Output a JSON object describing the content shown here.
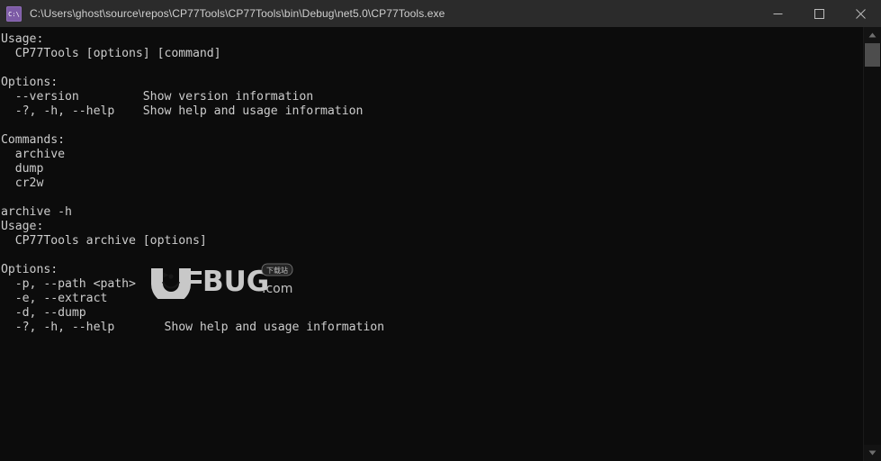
{
  "window": {
    "title": "C:\\Users\\ghost\\source\\repos\\CP77Tools\\CP77Tools\\bin\\Debug\\net5.0\\CP77Tools.exe",
    "icon": "console-app-icon",
    "icon_label": "C:\\",
    "background_color": "#0c0c0c",
    "titlebar_color": "#2b2b2b",
    "text_color": "#cccccc"
  },
  "window_controls": {
    "minimize_label": "Minimize",
    "maximize_label": "Maximize",
    "close_label": "Close"
  },
  "console": {
    "output": "Usage:\n  CP77Tools [options] [command]\n\nOptions:\n  --version         Show version information\n  -?, -h, --help    Show help and usage information\n\nCommands:\n  archive\n  dump\n  cr2w\n\narchive -h\nUsage:\n  CP77Tools archive [options]\n\nOptions:\n  -p, --path <path>\n  -e, --extract\n  -d, --dump\n  -?, -h, --help       Show help and usage information",
    "lines": [
      "Usage:",
      "  CP77Tools [options] [command]",
      "",
      "Options:",
      "  --version         Show version information",
      "  -?, -h, --help    Show help and usage information",
      "",
      "Commands:",
      "  archive",
      "  dump",
      "  cr2w",
      "",
      "archive -h",
      "Usage:",
      "  CP77Tools archive [options]",
      "",
      "Options:",
      "  -p, --path <path>",
      "  -e, --extract",
      "  -d, --dump",
      "  -?, -h, --help       Show help and usage information"
    ],
    "commands": [
      "archive",
      "dump",
      "cr2w"
    ],
    "global_options": [
      {
        "flags": "--version",
        "description": "Show version information"
      },
      {
        "flags": "-?, -h, --help",
        "description": "Show help and usage information"
      }
    ],
    "archive_options": [
      {
        "flags": "-p, --path <path>",
        "description": ""
      },
      {
        "flags": "-e, --extract",
        "description": ""
      },
      {
        "flags": "-d, --dump",
        "description": ""
      },
      {
        "flags": "-?, -h, --help",
        "description": "Show help and usage information"
      }
    ]
  },
  "watermark": {
    "text": "UCBUG",
    "suffix": ".com",
    "badge": "下载站"
  },
  "scrollbar": {
    "up_arrow": "scroll-up-arrow",
    "down_arrow": "scroll-down-arrow",
    "thumb": "scroll-thumb"
  }
}
